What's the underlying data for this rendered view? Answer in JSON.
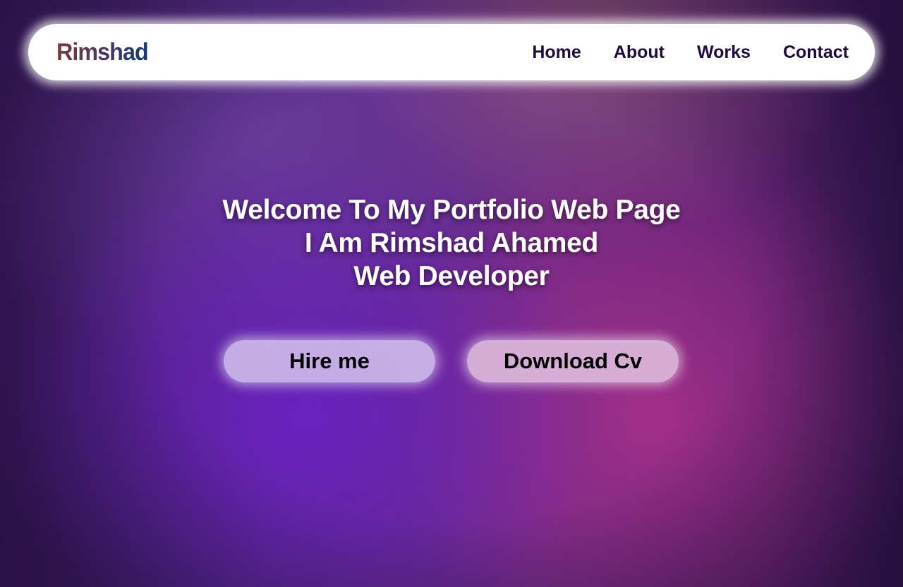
{
  "navbar": {
    "logo": "Rimshad",
    "links": [
      {
        "label": "Home"
      },
      {
        "label": "About"
      },
      {
        "label": "Works"
      },
      {
        "label": "Contact"
      }
    ]
  },
  "hero": {
    "lines": [
      "Welcome To My Portfolio Web Page",
      "I Am Rimshad Ahamed",
      "Web Developer"
    ],
    "buttons": {
      "hire": "Hire me",
      "download": "Download Cv"
    }
  },
  "colors": {
    "logo_gradient_start": "#7a3840",
    "logo_gradient_end": "#163a78",
    "nav_text": "#1e0c3e",
    "hero_text": "#ffffff",
    "background_purple": "#6c20c8",
    "background_magenta": "#ac308c"
  }
}
